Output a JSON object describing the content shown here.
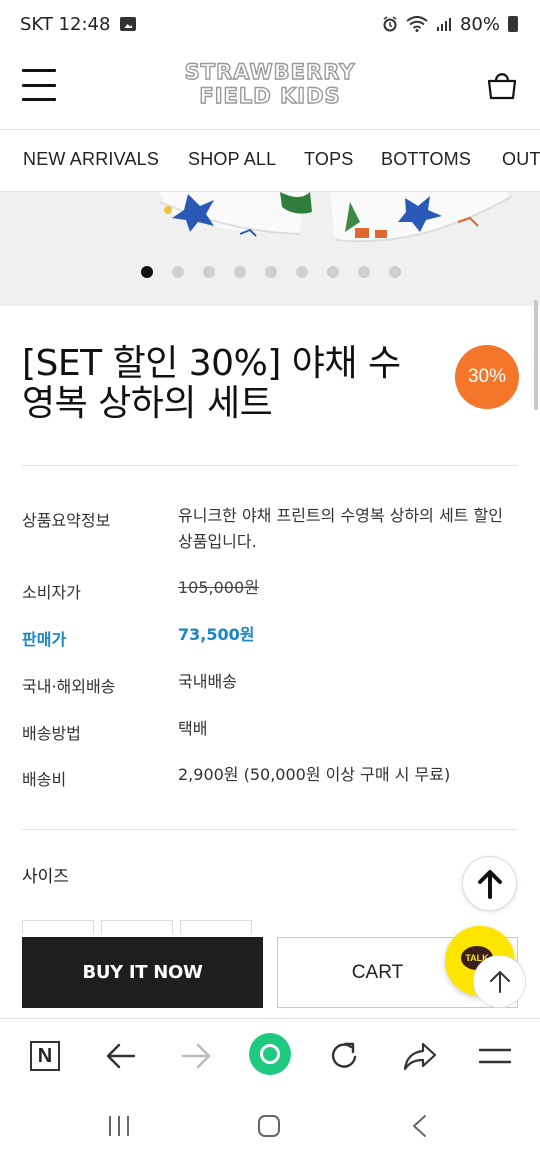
{
  "status_bar": {
    "carrier_time": "SKT 12:48",
    "battery": "80%"
  },
  "header": {
    "logo_line1": "STRAWBERRY",
    "logo_line2": "FIELD KIDS"
  },
  "nav": {
    "items": [
      "NEW ARRIVALS",
      "SHOP ALL",
      "TOPS",
      "BOTTOMS",
      "OUT"
    ]
  },
  "carousel": {
    "total_slides": 9,
    "active_index": 0
  },
  "product": {
    "title": "[SET 할인 30%] 야채 수영복 상하의 세트",
    "discount_badge": "30%"
  },
  "info": {
    "summary_label": "상품요약정보",
    "summary_value": "유니크한 야채 프린트의 수영복 상하의 세트 할인 상품입니다.",
    "consumer_price_label": "소비자가",
    "consumer_price_value": "105,000원",
    "sale_price_label": "판매가",
    "sale_price_value": "73,500원",
    "shipping_region_label": "국내·해외배송",
    "shipping_region_value": "국내배송",
    "shipping_method_label": "배송방법",
    "shipping_method_value": "택배",
    "shipping_fee_label": "배송비",
    "shipping_fee_value": "2,900원 (50,000원 이상 구매 시 무료)"
  },
  "options": {
    "size_label": "사이즈"
  },
  "actions": {
    "buy_now": "BUY IT NOW",
    "cart": "CART",
    "talk": "TALK"
  },
  "colors": {
    "sale_blue": "#1a86c4",
    "badge_orange": "#f4762b",
    "buy_black": "#1e1e1e",
    "kakao_yellow": "#fde500",
    "browser_green": "#1ec980"
  },
  "icons": {
    "status": [
      "image-icon",
      "alarm-icon",
      "wifi-icon",
      "signal-icon",
      "battery-icon"
    ],
    "browser": [
      "naver-n-icon",
      "back-arrow-icon",
      "forward-arrow-icon",
      "green-home-icon",
      "refresh-icon",
      "share-icon",
      "menu-icon"
    ],
    "system": [
      "recents-icon",
      "home-icon",
      "back-icon"
    ]
  }
}
